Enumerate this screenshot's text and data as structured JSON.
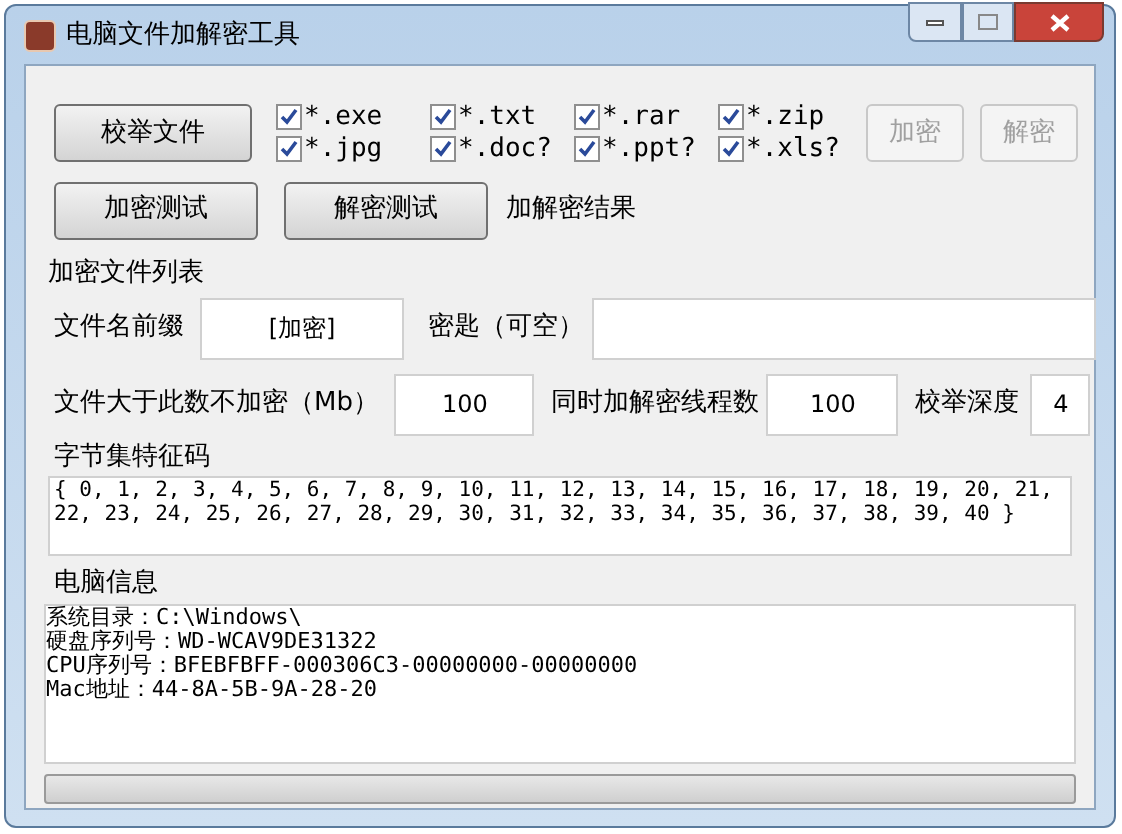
{
  "window": {
    "title": "电脑文件加解密工具"
  },
  "enumerate_button": {
    "label": "校举文件"
  },
  "file_types": [
    {
      "label": "*.exe",
      "checked": true
    },
    {
      "label": "*.txt",
      "checked": true
    },
    {
      "label": "*.rar",
      "checked": true
    },
    {
      "label": "*.zip",
      "checked": true
    },
    {
      "label": "*.jpg",
      "checked": true
    },
    {
      "label": "*.doc?",
      "checked": true
    },
    {
      "label": "*.ppt?",
      "checked": true
    },
    {
      "label": "*.xls?",
      "checked": true
    }
  ],
  "action_buttons": [
    {
      "label": "加密",
      "disabled": true
    },
    {
      "label": "解密",
      "disabled": true
    }
  ],
  "test_buttons": [
    {
      "label": "加密测试"
    },
    {
      "label": "解密测试"
    }
  ],
  "result_label": "加解密结果",
  "file_list_label": "加密文件列表",
  "prefix": {
    "label": "文件名前缀",
    "value": "[加密]"
  },
  "key": {
    "label": "密匙（可空）"
  },
  "max_size": {
    "label": "文件大于此数不加密（Mb）",
    "value": "100"
  },
  "threads": {
    "label": "同时加解密线程数",
    "value": "100"
  },
  "depth": {
    "label": "校举深度",
    "value": "4"
  },
  "signature": {
    "label": "字节集特征码",
    "value": "{ 0, 1, 2, 3, 4, 5, 6, 7, 8, 9, 10, 11, 12, 13, 14, 15, 16, 17, 18, 19, 20, 21, 22, 23, 24, 25, 26, 27, 28, 29, 30, 31, 32, 33, 34, 35, 36, 37, 38, 39, 40 }"
  },
  "computer_info": {
    "label": "电脑信息",
    "lines": [
      "系统目录：C:\\Windows\\",
      "硬盘序列号：WD-WCAV9DE31322",
      "CPU序列号：BFEBFBFF-000306C3-00000000-00000000",
      "Mac地址：44-8A-5B-9A-28-20"
    ]
  },
  "progress": {
    "level": 0
  }
}
